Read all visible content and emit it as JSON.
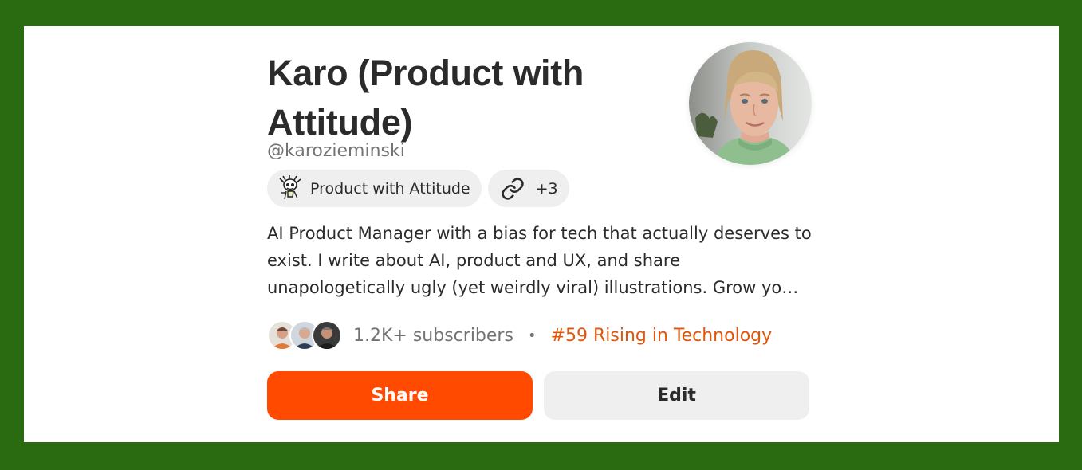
{
  "profile": {
    "name": "Karo (Product with Attitude)",
    "handle": "@karozieminski",
    "bio": "AI Product Manager with a bias for tech that actually deserves to exist. I write about AI, product and UX, and share unapologetically ugly (yet weirdly viral) illustrations. Grow yo…"
  },
  "chips": {
    "publication_label": "Product with Attitude",
    "publication_icon": "cartoon-character-icon",
    "links_icon": "link-icon",
    "links_count": "+3"
  },
  "stats": {
    "subscribers": "1.2K+ subscribers",
    "separator": "•",
    "ranking": "#59 Rising in Technology",
    "ranking_color": "#e2560a"
  },
  "actions": {
    "share_label": "Share",
    "edit_label": "Edit",
    "share_color": "#ff4a00"
  },
  "colors": {
    "frame": "#2a6a10",
    "card": "#ffffff",
    "text": "#2b2b2b",
    "muted": "#737373",
    "chip_bg": "#efefef"
  }
}
